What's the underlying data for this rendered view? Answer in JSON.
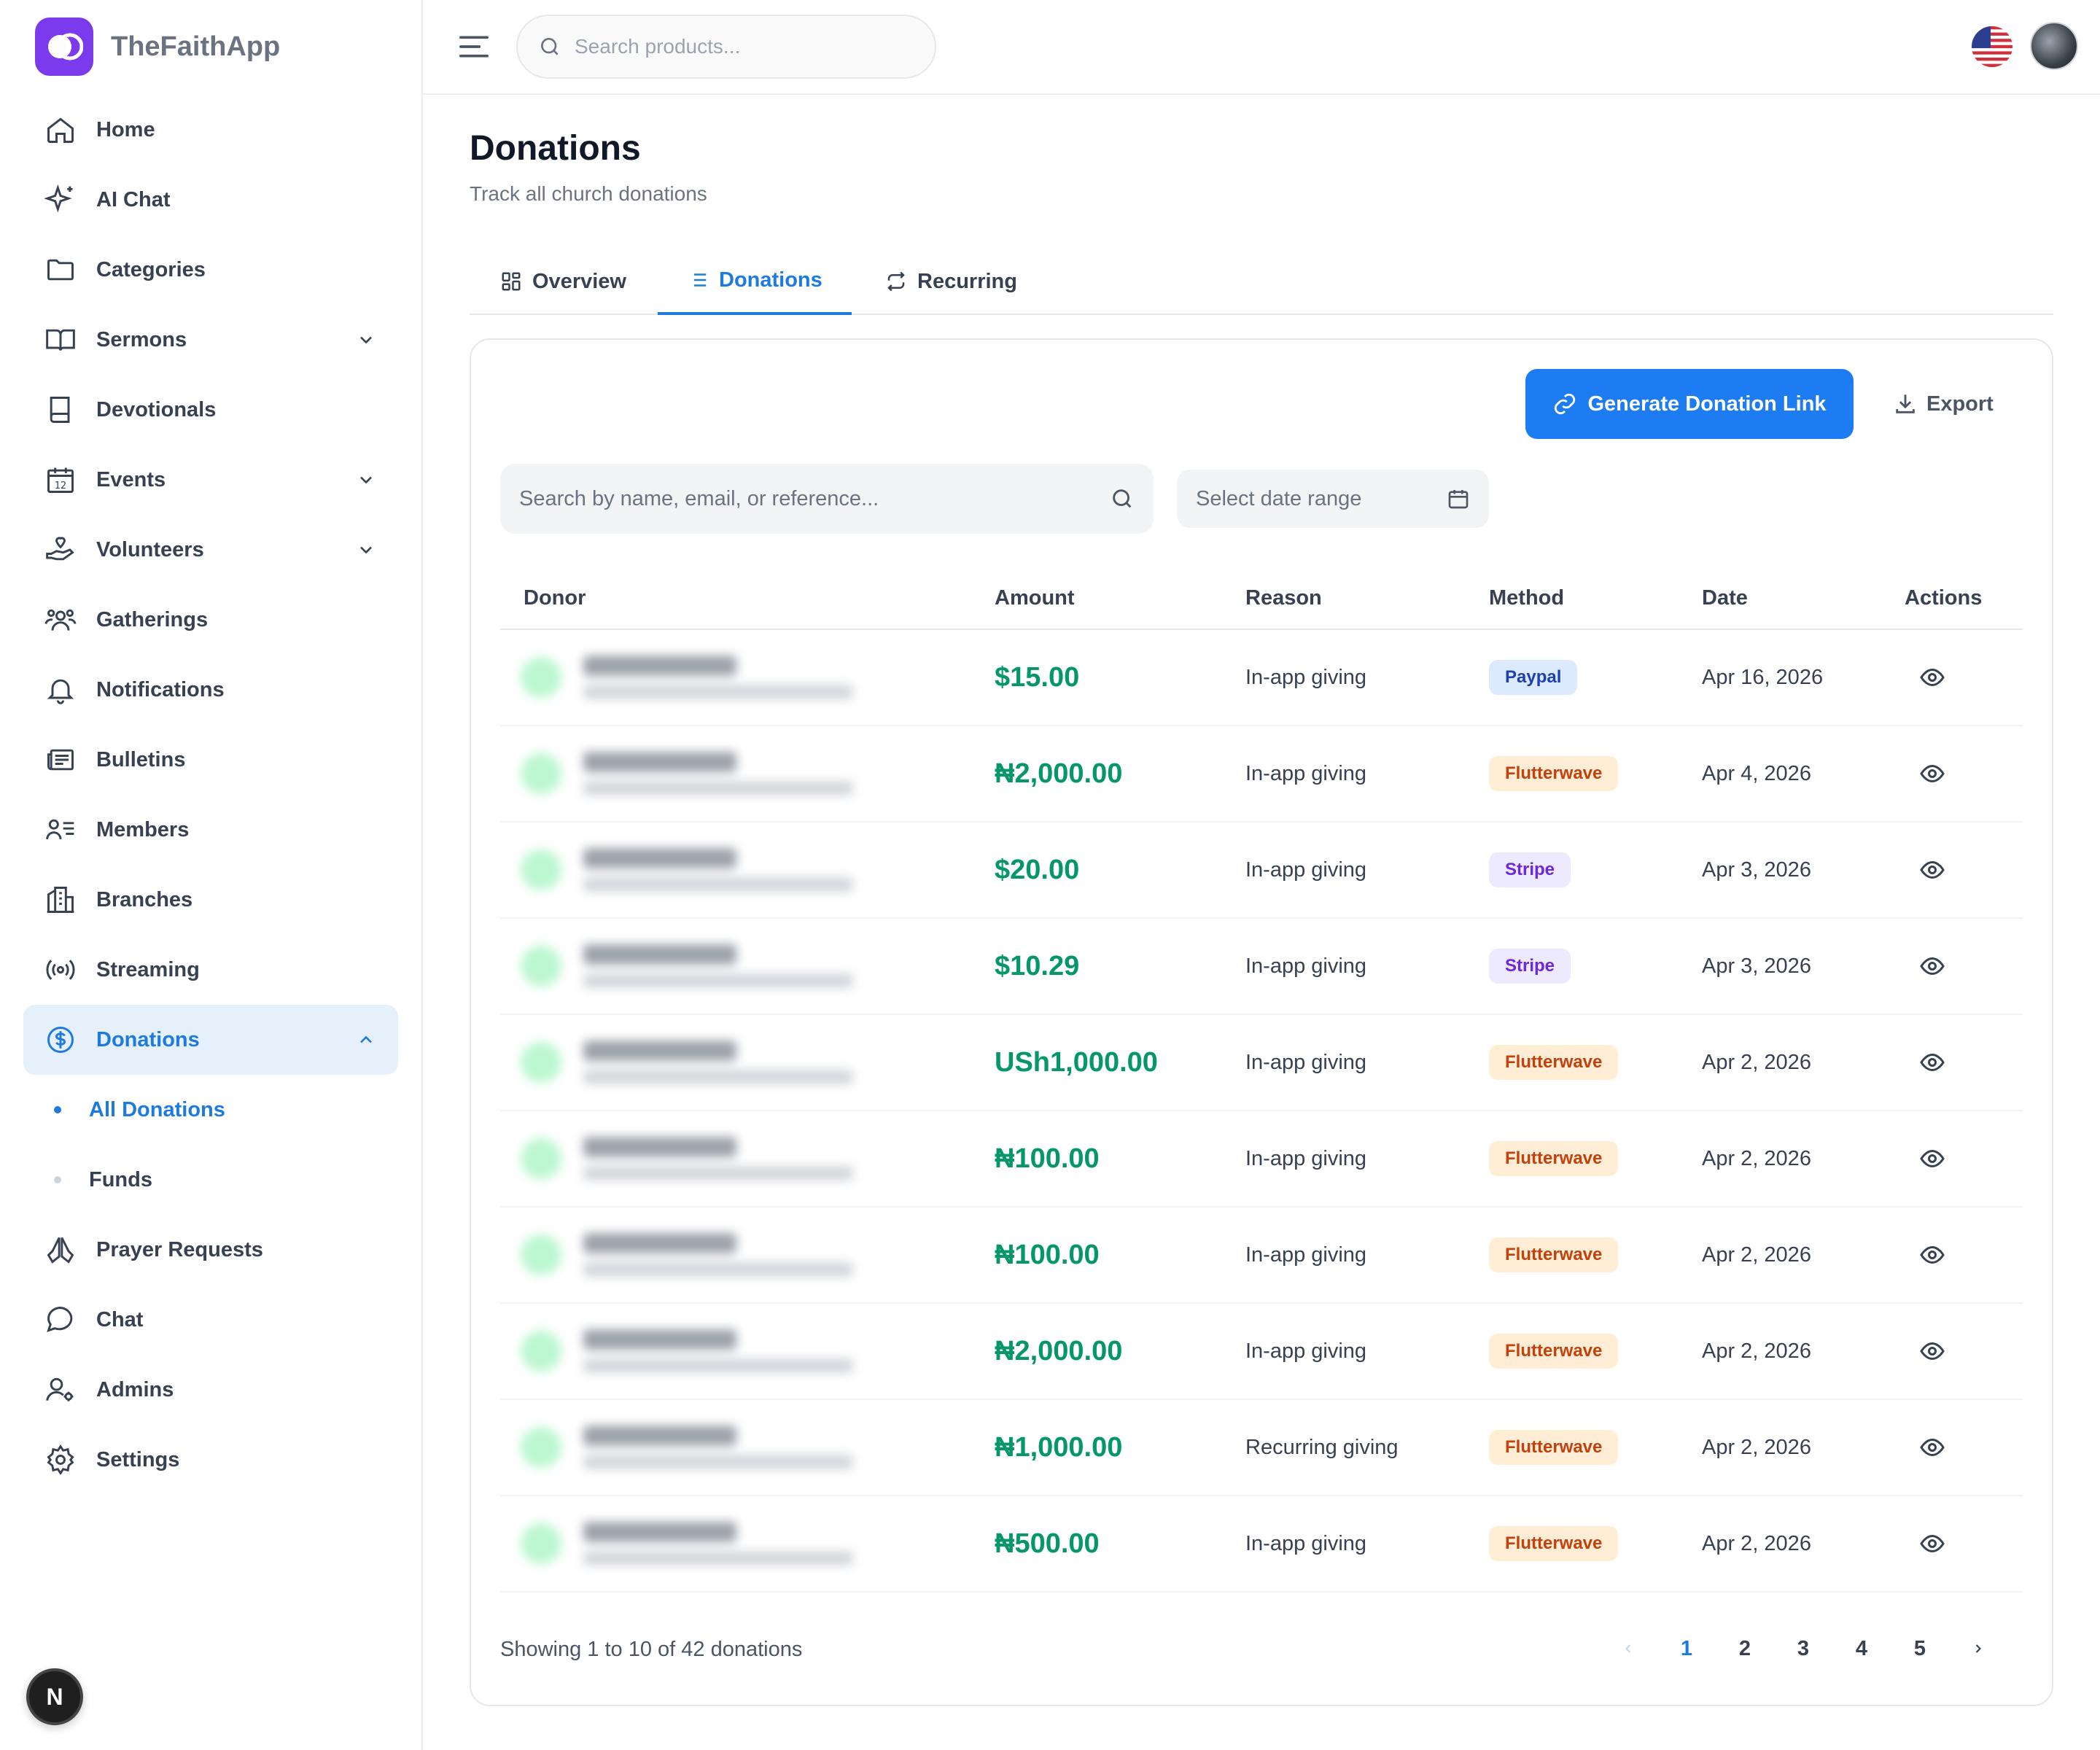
{
  "app": {
    "name": "TheFaithApp"
  },
  "header": {
    "search_placeholder": "Search products..."
  },
  "sidebar": {
    "items": [
      {
        "label": "Home",
        "icon": "home-icon"
      },
      {
        "label": "AI Chat",
        "icon": "sparkles-icon"
      },
      {
        "label": "Categories",
        "icon": "folder-icon"
      },
      {
        "label": "Sermons",
        "icon": "book-open-icon",
        "expandable": true
      },
      {
        "label": "Devotionals",
        "icon": "book-icon"
      },
      {
        "label": "Events",
        "icon": "calendar-icon",
        "expandable": true
      },
      {
        "label": "Volunteers",
        "icon": "hand-heart-icon",
        "expandable": true
      },
      {
        "label": "Gatherings",
        "icon": "users-icon"
      },
      {
        "label": "Notifications",
        "icon": "bell-icon"
      },
      {
        "label": "Bulletins",
        "icon": "newspaper-icon"
      },
      {
        "label": "Members",
        "icon": "user-list-icon"
      },
      {
        "label": "Branches",
        "icon": "building-icon"
      },
      {
        "label": "Streaming",
        "icon": "broadcast-icon"
      },
      {
        "label": "Donations",
        "icon": "dollar-circle-icon",
        "expanded": true,
        "active": true
      },
      {
        "label": "Prayer Requests",
        "icon": "praying-hands-icon"
      },
      {
        "label": "Chat",
        "icon": "chat-bubble-icon"
      },
      {
        "label": "Admins",
        "icon": "user-gear-icon"
      },
      {
        "label": "Settings",
        "icon": "gear-icon"
      }
    ],
    "donation_subitems": [
      {
        "label": "All Donations",
        "active": true
      },
      {
        "label": "Funds",
        "active": false
      }
    ],
    "corner_badge": "N"
  },
  "page": {
    "title": "Donations",
    "subtitle": "Track all church donations",
    "tabs": [
      {
        "label": "Overview",
        "active": false
      },
      {
        "label": "Donations",
        "active": true
      },
      {
        "label": "Recurring",
        "active": false
      }
    ]
  },
  "toolbar": {
    "generate_label": "Generate Donation Link",
    "export_label": "Export",
    "search_placeholder": "Search by name, email, or reference...",
    "date_placeholder": "Select date range"
  },
  "table": {
    "columns": [
      "Donor",
      "Amount",
      "Reason",
      "Method",
      "Date",
      "Actions"
    ],
    "rows": [
      {
        "amount": "$15.00",
        "reason": "In-app giving",
        "method": "Paypal",
        "date": "Apr 16, 2026"
      },
      {
        "amount": "₦2,000.00",
        "reason": "In-app giving",
        "method": "Flutterwave",
        "date": "Apr 4, 2026"
      },
      {
        "amount": "$20.00",
        "reason": "In-app giving",
        "method": "Stripe",
        "date": "Apr 3, 2026"
      },
      {
        "amount": "$10.29",
        "reason": "In-app giving",
        "method": "Stripe",
        "date": "Apr 3, 2026"
      },
      {
        "amount": "USh1,000.00",
        "reason": "In-app giving",
        "method": "Flutterwave",
        "date": "Apr 2, 2026"
      },
      {
        "amount": "₦100.00",
        "reason": "In-app giving",
        "method": "Flutterwave",
        "date": "Apr 2, 2026"
      },
      {
        "amount": "₦100.00",
        "reason": "In-app giving",
        "method": "Flutterwave",
        "date": "Apr 2, 2026"
      },
      {
        "amount": "₦2,000.00",
        "reason": "In-app giving",
        "method": "Flutterwave",
        "date": "Apr 2, 2026"
      },
      {
        "amount": "₦1,000.00",
        "reason": "Recurring giving",
        "method": "Flutterwave",
        "date": "Apr 2, 2026"
      },
      {
        "amount": "₦500.00",
        "reason": "In-app giving",
        "method": "Flutterwave",
        "date": "Apr 2, 2026"
      }
    ]
  },
  "pagination": {
    "summary": "Showing 1 to 10 of 42 donations",
    "pages": [
      "1",
      "2",
      "3",
      "4",
      "5"
    ],
    "current": "1"
  },
  "colors": {
    "accent": "#1d7be0",
    "brand": "#7c3aed",
    "amount": "#059669"
  }
}
